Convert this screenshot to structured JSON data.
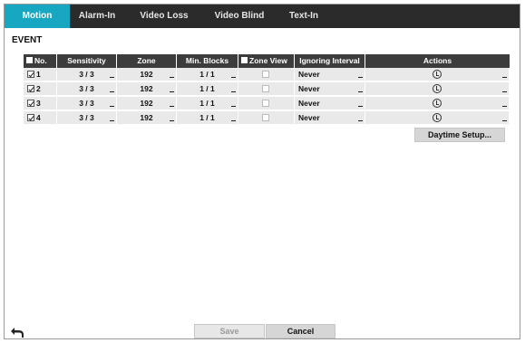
{
  "tabs": [
    {
      "label": "Motion",
      "active": true
    },
    {
      "label": "Alarm-In",
      "active": false
    },
    {
      "label": "Video Loss",
      "active": false
    },
    {
      "label": "Video Blind",
      "active": false
    },
    {
      "label": "Text-In",
      "active": false
    }
  ],
  "section_title": "EVENT",
  "table": {
    "headers": {
      "no": "No.",
      "sensitivity": "Sensitivity",
      "zone": "Zone",
      "min_blocks": "Min. Blocks",
      "zone_view": "Zone View",
      "ignoring_interval": "Ignoring Interval",
      "actions": "Actions"
    },
    "rows": [
      {
        "no": "1",
        "checked": true,
        "sensitivity": "3 / 3",
        "zone": "192",
        "min_blocks": "1 / 1",
        "zone_view": false,
        "ignoring_interval": "Never"
      },
      {
        "no": "2",
        "checked": true,
        "sensitivity": "3 / 3",
        "zone": "192",
        "min_blocks": "1 / 1",
        "zone_view": false,
        "ignoring_interval": "Never"
      },
      {
        "no": "3",
        "checked": true,
        "sensitivity": "3 / 3",
        "zone": "192",
        "min_blocks": "1 / 1",
        "zone_view": false,
        "ignoring_interval": "Never"
      },
      {
        "no": "4",
        "checked": true,
        "sensitivity": "3 / 3",
        "zone": "192",
        "min_blocks": "1 / 1",
        "zone_view": false,
        "ignoring_interval": "Never"
      }
    ],
    "action_icon": "settings-clock-icon"
  },
  "buttons": {
    "daytime_setup": "Daytime Setup...",
    "save": "Save",
    "cancel": "Cancel"
  },
  "back_icon": "return-arrow-icon",
  "colors": {
    "tabbar_bg": "#2b2b2b",
    "tab_active_bg": "#17a7c0",
    "header_bg": "#3c3c3c",
    "row_bg": "#e9e9e9"
  }
}
